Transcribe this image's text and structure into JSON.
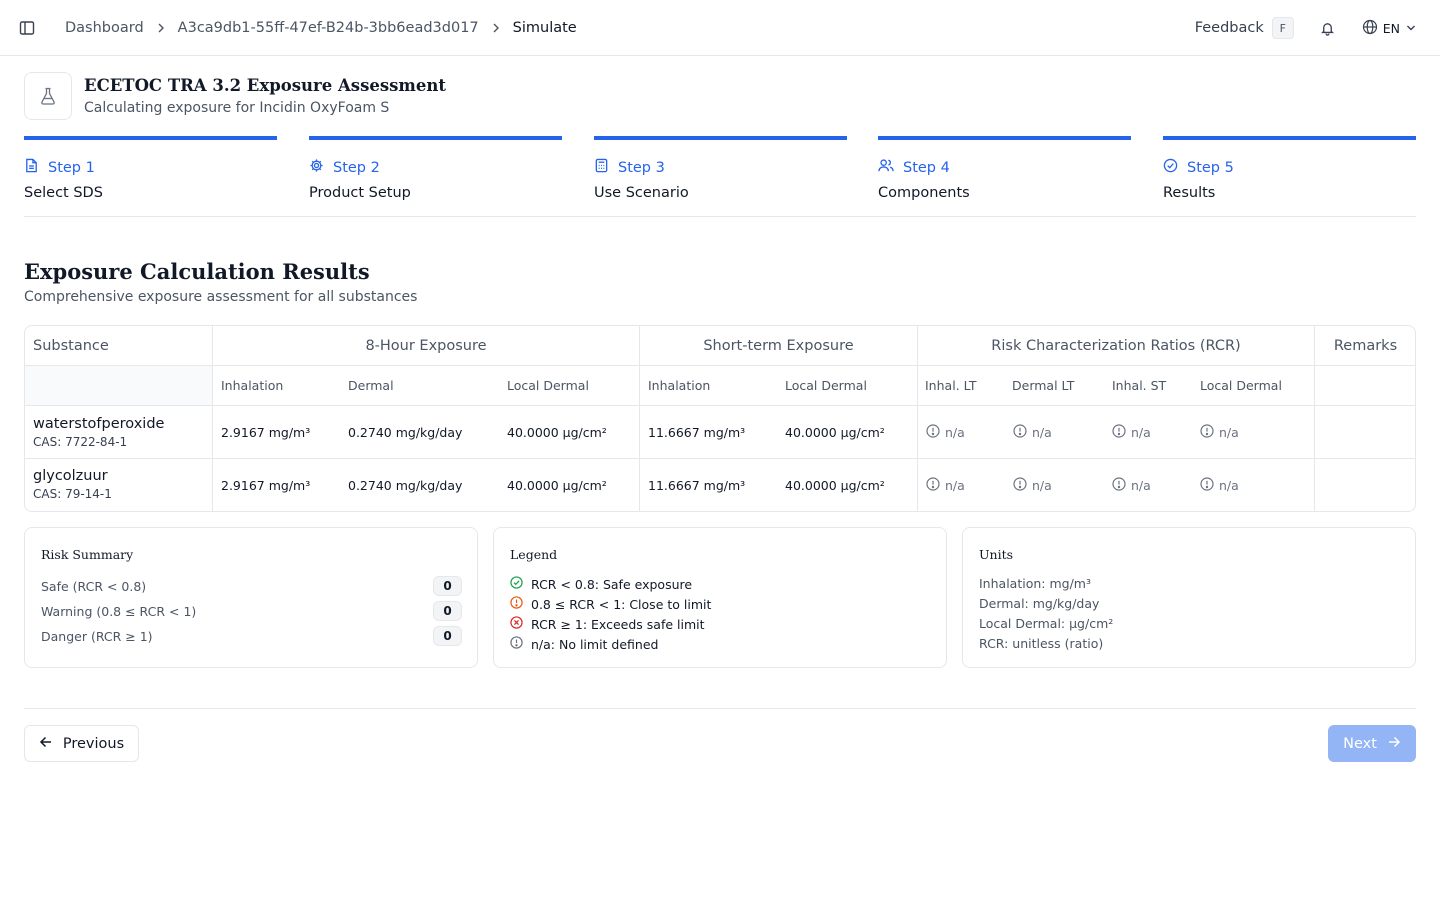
{
  "breadcrumb": {
    "items": [
      "Dashboard",
      "A3ca9db1-55ff-47ef-B24b-3bb6ead3d017",
      "Simulate"
    ]
  },
  "topbar": {
    "feedback_label": "Feedback",
    "feedback_shortcut": "F",
    "language": "EN"
  },
  "header": {
    "title": "ECETOC TRA 3.2 Exposure Assessment",
    "subtitle": "Calculating exposure for Incidin OxyFoam S"
  },
  "steps": [
    {
      "num": "Step 1",
      "label": "Select SDS",
      "icon": "document-icon"
    },
    {
      "num": "Step 2",
      "label": "Product Setup",
      "icon": "gear-icon"
    },
    {
      "num": "Step 3",
      "label": "Use Scenario",
      "icon": "calculator-icon"
    },
    {
      "num": "Step 4",
      "label": "Components",
      "icon": "users-icon"
    },
    {
      "num": "Step 5",
      "label": "Results",
      "icon": "check-circle-icon"
    }
  ],
  "results": {
    "title": "Exposure Calculation Results",
    "subtitle": "Comprehensive exposure assessment for all substances"
  },
  "table": {
    "group_headers": {
      "substance": "Substance",
      "eight_hour": "8-Hour Exposure",
      "short_term": "Short-term Exposure",
      "rcr": "Risk Characterization Ratios (RCR)",
      "remarks": "Remarks"
    },
    "sub_headers": {
      "eh_inhalation": "Inhalation",
      "eh_dermal": "Dermal",
      "eh_local_dermal": "Local Dermal",
      "st_inhalation": "Inhalation",
      "st_local_dermal": "Local Dermal",
      "rcr_inhal_lt": "Inhal. LT",
      "rcr_dermal_lt": "Dermal LT",
      "rcr_inhal_st": "Inhal. ST",
      "rcr_local_dermal": "Local Dermal"
    },
    "rows": [
      {
        "name": "waterstofperoxide",
        "cas": "CAS: 7722-84-1",
        "eh_inhalation": "2.9167 mg/m³",
        "eh_dermal": "0.2740 mg/kg/day",
        "eh_local_dermal": "40.0000 µg/cm²",
        "st_inhalation": "11.6667 mg/m³",
        "st_local_dermal": "40.0000 µg/cm²",
        "rcr_inhal_lt": "n/a",
        "rcr_dermal_lt": "n/a",
        "rcr_inhal_st": "n/a",
        "rcr_local_dermal": "n/a",
        "remarks": ""
      },
      {
        "name": "glycolzuur",
        "cas": "CAS: 79-14-1",
        "eh_inhalation": "2.9167 mg/m³",
        "eh_dermal": "0.2740 mg/kg/day",
        "eh_local_dermal": "40.0000 µg/cm²",
        "st_inhalation": "11.6667 mg/m³",
        "st_local_dermal": "40.0000 µg/cm²",
        "rcr_inhal_lt": "n/a",
        "rcr_dermal_lt": "n/a",
        "rcr_inhal_st": "n/a",
        "rcr_local_dermal": "n/a",
        "remarks": ""
      }
    ]
  },
  "risk_summary": {
    "title": "Risk Summary",
    "items": [
      {
        "label": "Safe (RCR < 0.8)",
        "count": "0"
      },
      {
        "label": "Warning (0.8 ≤ RCR < 1)",
        "count": "0"
      },
      {
        "label": "Danger (RCR ≥ 1)",
        "count": "0"
      }
    ]
  },
  "legend": {
    "title": "Legend",
    "items": [
      {
        "label": "RCR < 0.8: Safe exposure",
        "icon": "check-circle-icon",
        "color": "#16a34a"
      },
      {
        "label": "0.8 ≤ RCR < 1: Close to limit",
        "icon": "alert-circle-icon",
        "color": "#ea580c"
      },
      {
        "label": "RCR ≥ 1: Exceeds safe limit",
        "icon": "x-circle-icon",
        "color": "#dc2626"
      },
      {
        "label": "n/a: No limit defined",
        "icon": "info-circle-icon",
        "color": "#6b7280"
      }
    ]
  },
  "units": {
    "title": "Units",
    "items": [
      "Inhalation: mg/m³",
      "Dermal: mg/kg/day",
      "Local Dermal: µg/cm²",
      "RCR: unitless (ratio)"
    ]
  },
  "nav": {
    "previous": "Previous",
    "next": "Next"
  },
  "colors": {
    "accent": "#2563eb",
    "next_disabled": "#93b4f5"
  }
}
